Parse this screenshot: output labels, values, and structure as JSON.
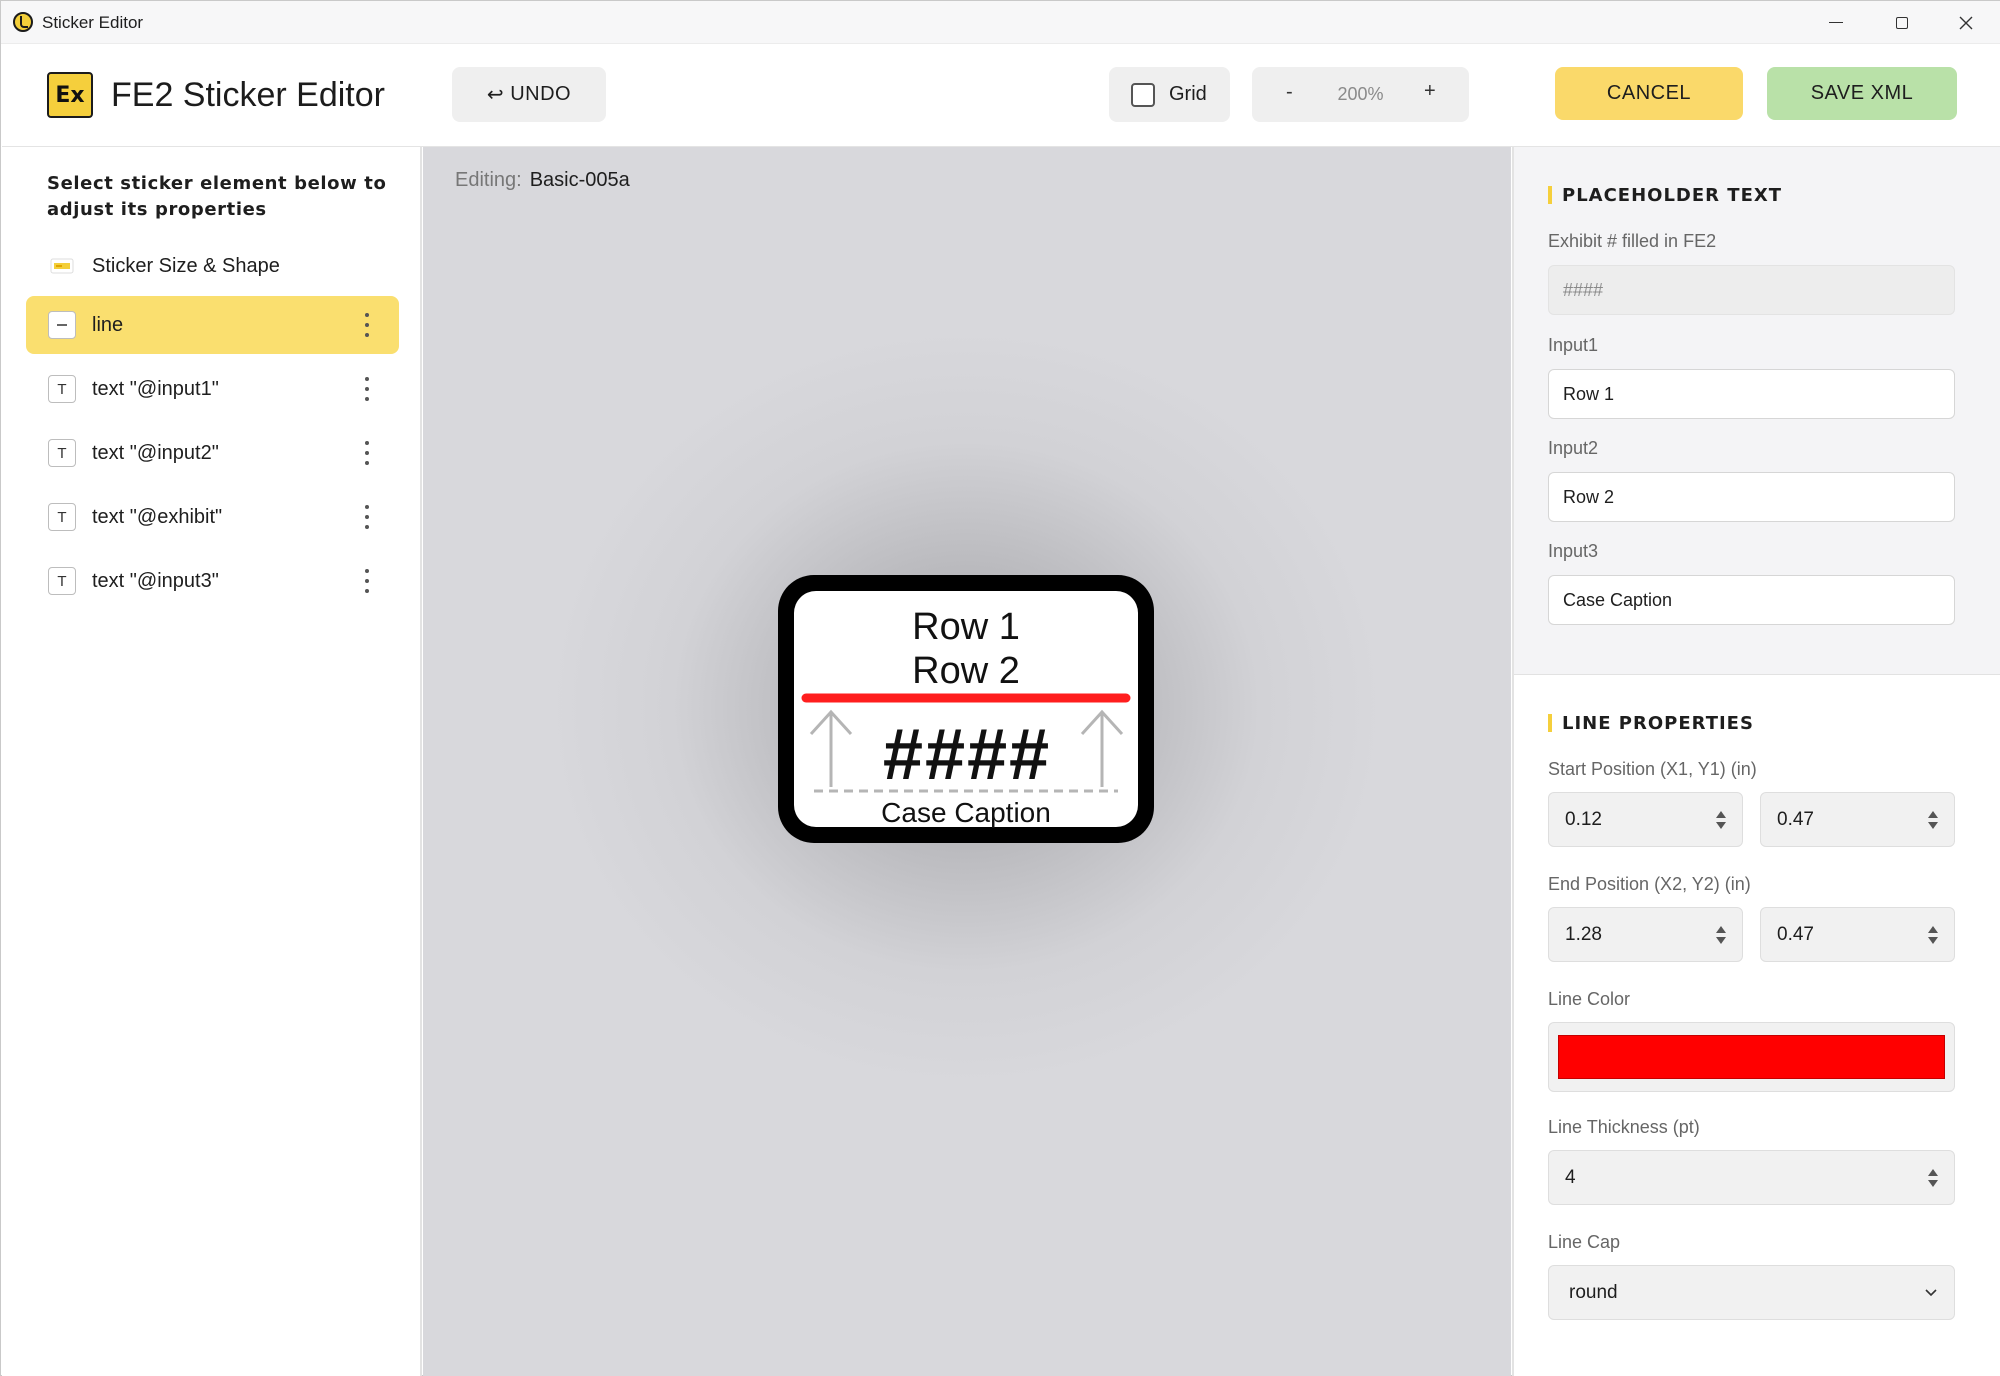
{
  "window": {
    "title": "Sticker Editor"
  },
  "header": {
    "logo": "Ex",
    "app_name": "FE2 Sticker Editor",
    "undo_label": "UNDO",
    "grid_label": "Grid",
    "grid_checked": false,
    "zoom_minus": "-",
    "zoom_value": "200%",
    "zoom_plus": "+",
    "cancel_label": "CANCEL",
    "save_label": "SAVE XML"
  },
  "sidebar": {
    "hint": "Select sticker element below to adjust its properties",
    "items": [
      {
        "label": "Sticker Size & Shape",
        "icon": "sticker-shape-icon",
        "active": false
      },
      {
        "label": "line",
        "icon": "line-icon",
        "active": true
      },
      {
        "label": "text \"@input1\"",
        "icon": "text-icon",
        "active": false
      },
      {
        "label": "text \"@input2\"",
        "icon": "text-icon",
        "active": false
      },
      {
        "label": "text \"@exhibit\"",
        "icon": "text-icon",
        "active": false
      },
      {
        "label": "text \"@input3\"",
        "icon": "text-icon",
        "active": false
      }
    ]
  },
  "canvas": {
    "editing_label": "Editing:",
    "editing_value": "Basic-005a",
    "sticker": {
      "row1": "Row 1",
      "row2": "Row 2",
      "exhibit": "####",
      "caption": "Case Caption"
    }
  },
  "placeholder": {
    "title": "PLACEHOLDER TEXT",
    "exhibit_label": "Exhibit # filled in FE2",
    "exhibit_value": "####",
    "input1_label": "Input1",
    "input1_value": "Row 1",
    "input2_label": "Input2",
    "input2_value": "Row 2",
    "input3_label": "Input3",
    "input3_value": "Case Caption"
  },
  "line_props": {
    "title": "LINE PROPERTIES",
    "start_label": "Start Position (X1, Y1) (in)",
    "x1": "0.12",
    "y1": "0.47",
    "end_label": "End Position (X2, Y2) (in)",
    "x2": "1.28",
    "y2": "0.47",
    "color_label": "Line Color",
    "color": "#ff0000",
    "thickness_label": "Line Thickness (pt)",
    "thickness": "4",
    "cap_label": "Line Cap",
    "cap": "round"
  },
  "colors": {
    "accent_yellow": "#fad96a",
    "save_green": "#b9e1a8",
    "active_item": "#fadf6f"
  }
}
